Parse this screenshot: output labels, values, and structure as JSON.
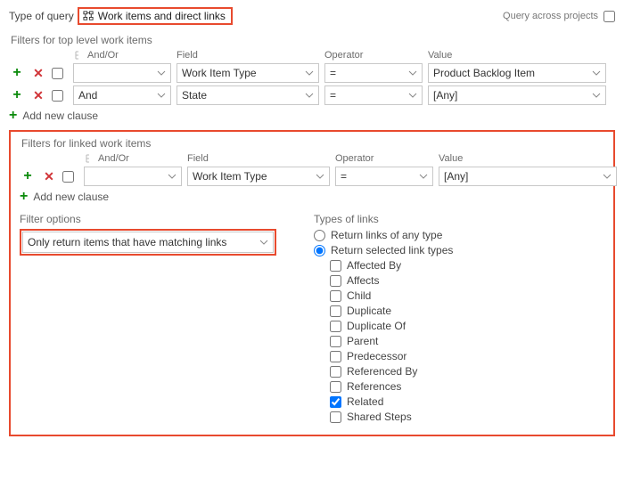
{
  "top": {
    "type_of_query_label": "Type of query",
    "query_type_value": "Work items and direct links",
    "query_across_label": "Query across projects",
    "query_across_checked": false
  },
  "sections": {
    "top_level_title": "Filters for top level work items",
    "linked_title": "Filters for linked work items"
  },
  "headers": {
    "and_or": "And/Or",
    "field": "Field",
    "operator": "Operator",
    "value": "Value"
  },
  "top_clauses": [
    {
      "and_or": "",
      "field": "Work Item Type",
      "operator": "=",
      "value": "Product Backlog Item"
    },
    {
      "and_or": "And",
      "field": "State",
      "operator": "=",
      "value": "[Any]"
    }
  ],
  "linked_clauses": [
    {
      "and_or": "",
      "field": "Work Item Type",
      "operator": "=",
      "value": "[Any]"
    }
  ],
  "add_new_clause": "Add new clause",
  "filter_options": {
    "title": "Filter options",
    "value": "Only return items that have matching links"
  },
  "types_of_links": {
    "title": "Types of links",
    "radio_any": "Return links of any type",
    "radio_selected": "Return selected link types",
    "radio_choice": "selected",
    "link_types": [
      {
        "label": "Affected By",
        "checked": false
      },
      {
        "label": "Affects",
        "checked": false
      },
      {
        "label": "Child",
        "checked": false
      },
      {
        "label": "Duplicate",
        "checked": false
      },
      {
        "label": "Duplicate Of",
        "checked": false
      },
      {
        "label": "Parent",
        "checked": false
      },
      {
        "label": "Predecessor",
        "checked": false
      },
      {
        "label": "Referenced By",
        "checked": false
      },
      {
        "label": "References",
        "checked": false
      },
      {
        "label": "Related",
        "checked": true
      },
      {
        "label": "Shared Steps",
        "checked": false
      }
    ]
  }
}
